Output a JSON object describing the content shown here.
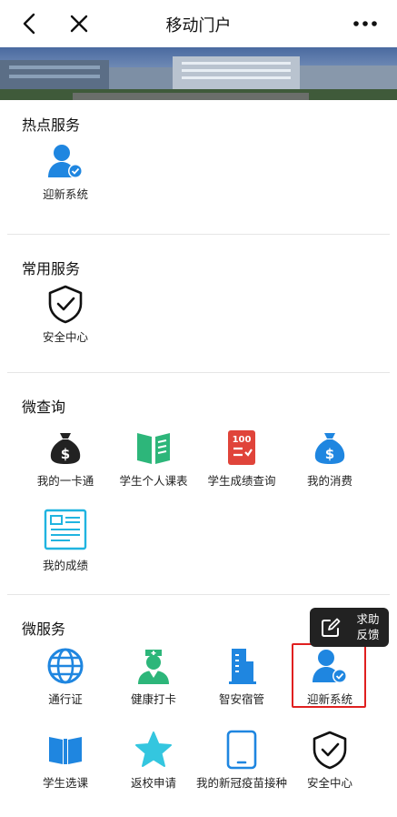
{
  "header": {
    "title": "移动门户"
  },
  "sections": {
    "hot": {
      "title": "热点服务",
      "items": [
        "迎新系统"
      ]
    },
    "common": {
      "title": "常用服务",
      "items": [
        "安全中心"
      ]
    },
    "query": {
      "title": "微查询",
      "items": [
        "我的一卡通",
        "学生个人课表",
        "学生成绩查询",
        "我的消费",
        "我的成绩"
      ]
    },
    "service": {
      "title": "微服务",
      "items": [
        "通行证",
        "健康打卡",
        "智安宿管",
        "迎新系统",
        "学生选课",
        "返校申请",
        "我的新冠疫苗接种",
        "安全中心"
      ]
    }
  },
  "help_button": {
    "label": "求助反馈"
  },
  "colors": {
    "accent_blue": "#1f86e0",
    "green": "#2db67a",
    "red": "#e0443a",
    "highlight": "#e02020"
  }
}
